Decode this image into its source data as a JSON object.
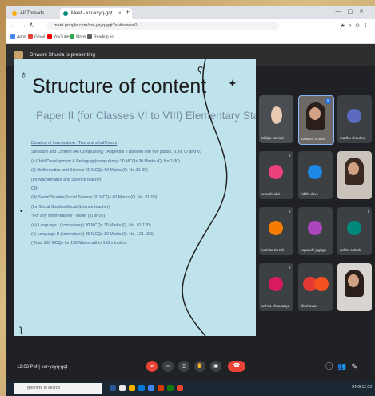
{
  "browser": {
    "tabs": [
      {
        "label": "All Threads",
        "color": "#f9ab00"
      },
      {
        "label": "Meet - xxr-xxyq-gqt",
        "color": "#00897b"
      }
    ],
    "url": "meet.google.com/xxr-yxyq-gqt?authuser=0",
    "bookmarks": [
      "Apps",
      "Gmail",
      "YouTube",
      "Maps",
      "Reading list"
    ]
  },
  "presentation": {
    "presenter_text": "Dhwani Shukla is presenting"
  },
  "slide": {
    "title": "Structure of content",
    "subtitle": "Paper II (for Classes VI to VIII) Elementary Stage",
    "lines": [
      "Duration of examination : Two and a half hours",
      "Structure and Content (All Compulsory) : Appendix II (divided into five parts I, II, III, IV and V)",
      "(i) Child Development & Pedagogy(compulsory) 30 MCQs 30 Marks (Q. No.1-30)",
      "(ii) Mathematics and Science 60 MCQs 60 Marks (Q. No.31-90)",
      "(for Mathematics and Science teacher)",
      "OR",
      "(iii) Social Studies/Social Science 60 MCQs 60 Marks (Q. No. 31-90)",
      "(for Social Studies/Social Science teacher)",
      "*For any other teacher - either (II) or (III)",
      "(iv) Language I (compulsory) 30 MCQs 30 Marks (Q. No. 91-120)",
      "(v) Language II (compulsory) 30 MCQs 30 Marks (Q. No. 121-150)",
      "( Total 150 MCQs for 150 Marks within 150 minutes)"
    ]
  },
  "participants": [
    {
      "name": "Shilpa Bansal",
      "initial": "",
      "color": "",
      "photo": true
    },
    {
      "name": "Dhwani Shukla",
      "initial": "",
      "color": "",
      "photo": true
    },
    {
      "name": "madhu chauhan",
      "initial": "",
      "color": "#5c6bc0",
      "photo": false
    },
    {
      "name": "urvashi ahir",
      "initial": "",
      "color": "#ec407a",
      "photo": false
    },
    {
      "name": "riddhi dave",
      "initial": "",
      "color": "#1e88e5",
      "photo": false
    },
    {
      "name": "",
      "initial": "",
      "color": "",
      "photo": true
    },
    {
      "name": "rushika trivedi",
      "initial": "",
      "color": "#f57c00",
      "photo": false
    },
    {
      "name": "rupanshi jaghgu",
      "initial": "",
      "color": "#ab47bc",
      "photo": false
    },
    {
      "name": "ankita solanki",
      "initial": "",
      "color": "#00897b",
      "photo": false
    },
    {
      "name": "arthita chhasatiya",
      "initial": "",
      "color": "#d81b60",
      "photo": false
    },
    {
      "name": "dk chavan",
      "initial": "",
      "color": "#e53935",
      "photo": false
    },
    {
      "name": "",
      "initial": "",
      "color": "",
      "photo": true
    }
  ],
  "meetbar": {
    "time_code": "12:03 PM | xxr-yxyq-gqt",
    "controls": [
      "mic-off",
      "camera-off",
      "captions",
      "raise-hand",
      "present",
      "more"
    ],
    "leave_icon": "phone-hangup"
  },
  "taskbar": {
    "search_placeholder": "Type here to search",
    "tray_text": "ENG 12:03"
  }
}
